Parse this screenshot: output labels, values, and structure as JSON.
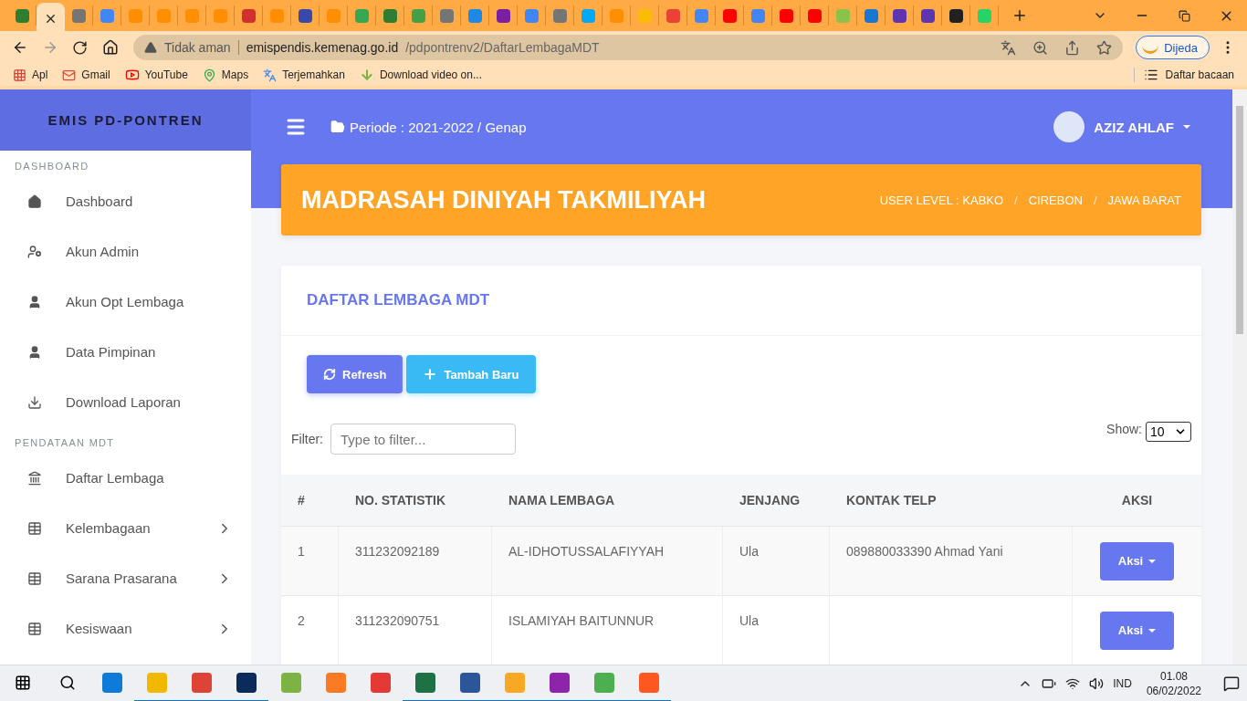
{
  "browser": {
    "tabs": [
      {
        "selected": false,
        "color": "#2e7d32"
      },
      {
        "selected": true
      },
      {
        "selected": false,
        "color": "#757575"
      },
      {
        "selected": false,
        "color": "#4285f4"
      },
      {
        "selected": false,
        "color": "#ff8f00"
      },
      {
        "selected": false,
        "color": "#ff8f00"
      },
      {
        "selected": false,
        "color": "#ff8f00"
      },
      {
        "selected": false,
        "color": "#ff8f00"
      },
      {
        "selected": false,
        "color": "#d32f2f"
      },
      {
        "selected": false,
        "color": "#ff8f00"
      },
      {
        "selected": false,
        "color": "#3949ab"
      },
      {
        "selected": false,
        "color": "#ff8f00"
      },
      {
        "selected": false,
        "color": "#34a853"
      },
      {
        "selected": false,
        "color": "#2e7d32"
      },
      {
        "selected": false,
        "color": "#43a047"
      },
      {
        "selected": false,
        "color": "#757575"
      },
      {
        "selected": false,
        "color": "#1e88e5"
      },
      {
        "selected": false,
        "color": "#7b1fa2"
      },
      {
        "selected": false,
        "color": "#4285f4"
      },
      {
        "selected": false,
        "color": "#757575"
      },
      {
        "selected": false,
        "color": "#03a9f4"
      },
      {
        "selected": false,
        "color": "#ff8f00"
      },
      {
        "selected": false,
        "color": "#fbbc04"
      },
      {
        "selected": false,
        "color": "#ea4335"
      },
      {
        "selected": false,
        "color": "#4285f4"
      },
      {
        "selected": false,
        "color": "#ff0000"
      },
      {
        "selected": false,
        "color": "#4285f4"
      },
      {
        "selected": false,
        "color": "#ff0000"
      },
      {
        "selected": false,
        "color": "#ff0000"
      },
      {
        "selected": false,
        "color": "#8bc34a"
      },
      {
        "selected": false,
        "color": "#1976d2"
      },
      {
        "selected": false,
        "color": "#5e35b1"
      },
      {
        "selected": false,
        "color": "#5e35b1"
      },
      {
        "selected": false,
        "color": "#212121"
      },
      {
        "selected": false,
        "color": "#25d366"
      }
    ],
    "security": "Tidak aman",
    "url_host": "emispendis.kemenag.go.id",
    "url_path": "/pdpontrenv2/DaftarLembagaMDT",
    "profile": "Dijeda",
    "bookmarks": [
      {
        "kind": "apps",
        "label": "Apl"
      },
      {
        "kind": "mail",
        "label": "Gmail"
      },
      {
        "kind": "video",
        "label": "YouTube"
      },
      {
        "kind": "map",
        "label": "Maps"
      },
      {
        "kind": "translate",
        "label": "Terjemahkan"
      },
      {
        "kind": "download",
        "label": "Download video on..."
      }
    ],
    "reading_list": "Daftar bacaan"
  },
  "sidebar": {
    "brand": "EMIS PD-PONTREN",
    "sections": [
      {
        "title": "DASHBOARD",
        "items": [
          {
            "kind": "home",
            "label": "Dashboard",
            "expandable": false
          },
          {
            "kind": "admin",
            "label": "Akun Admin",
            "expandable": false
          },
          {
            "kind": "user",
            "label": "Akun Opt Lembaga",
            "expandable": false
          },
          {
            "kind": "user",
            "label": "Data Pimpinan",
            "expandable": false
          },
          {
            "kind": "download",
            "label": "Download Laporan",
            "expandable": false
          }
        ]
      },
      {
        "title": "PENDATAAN MDT",
        "items": [
          {
            "kind": "bank",
            "label": "Daftar Lembaga",
            "expandable": false
          },
          {
            "kind": "table",
            "label": "Kelembagaan",
            "expandable": true
          },
          {
            "kind": "table",
            "label": "Sarana Prasarana",
            "expandable": true
          },
          {
            "kind": "table",
            "label": "Kesiswaan",
            "expandable": true
          }
        ]
      }
    ]
  },
  "topbar": {
    "periode": "Periode : 2021-2022 / Genap",
    "user": "AZIZ AHLAF"
  },
  "banner": {
    "title": "MADRASAH DINIYAH TAKMILIYAH",
    "breadcrumb": [
      {
        "label": "USER LEVEL : KABKO"
      },
      {
        "separator": "/",
        "label": "CIREBON"
      },
      {
        "separator": "/",
        "label": "JAWA BARAT"
      }
    ]
  },
  "card": {
    "title": "DAFTAR LEMBAGA MDT",
    "buttons": [
      {
        "kind": "refresh",
        "label": "Refresh"
      },
      {
        "kind": "add",
        "label": "Tambah Baru"
      }
    ],
    "filter": {
      "label": "Filter:",
      "placeholder": "Type to filter..."
    },
    "show": {
      "label": "Show:",
      "value": "10"
    },
    "table": {
      "columns": [
        "#",
        "NO. STATISTIK",
        "NAMA LEMBAGA",
        "JENJANG",
        "KONTAK TELP",
        "AKSI"
      ],
      "rows": [
        {
          "no": "1",
          "statistik": "311232092189",
          "nama": "AL-IDHOTUSSALAFIYYAH",
          "jenjang": "Ula",
          "kontak": "089880033390 Ahmad Yani",
          "aksi": "Aksi"
        },
        {
          "no": "2",
          "statistik": "311232090751",
          "nama": "ISLAMIYAH BAITUNNUR",
          "jenjang": "Ula",
          "aksi": "Aksi"
        }
      ]
    }
  },
  "taskbar": {
    "apps": [
      {
        "color": "#0f7bd8",
        "open": false
      },
      {
        "color": "#f2b800",
        "open": true
      },
      {
        "color": "#db4437",
        "open": true
      },
      {
        "color": "#0b2c5a",
        "open": true
      },
      {
        "color": "#7cb342",
        "open": false
      },
      {
        "color": "#fb7a24",
        "open": false
      },
      {
        "color": "#e53935",
        "open": false
      },
      {
        "color": "#1e7145",
        "open": true
      },
      {
        "color": "#2b579a",
        "open": true
      },
      {
        "color": "#f9a825",
        "open": true
      },
      {
        "color": "#8e24aa",
        "open": true
      },
      {
        "color": "#4caf50",
        "open": true
      },
      {
        "color": "#ff5722",
        "open": true
      }
    ],
    "language": "IND",
    "time": "01.08",
    "date": "06/02/2022"
  }
}
